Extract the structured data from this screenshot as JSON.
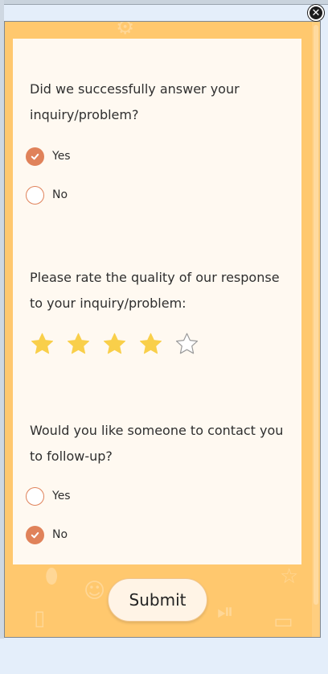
{
  "survey": {
    "q1": {
      "text": "Did we successfully answer your inquiry/problem?",
      "options": [
        {
          "label": "Yes",
          "checked": true
        },
        {
          "label": "No",
          "checked": false
        }
      ]
    },
    "q2": {
      "text": "Please rate the quality of our response to your inquiry/problem:",
      "rating": 4,
      "max_rating": 5
    },
    "q3": {
      "text": "Would you like someone to contact you to follow-up?",
      "options": [
        {
          "label": "Yes",
          "checked": false
        },
        {
          "label": "No",
          "checked": true
        }
      ]
    },
    "submit_label": "Submit"
  },
  "icons": {
    "close": "close-icon",
    "check": "checkmark-icon",
    "star": "star-icon"
  },
  "colors": {
    "background": "#ffc86e",
    "card": "#fff9f1",
    "accent": "#e0825a",
    "star_filled": "#f9cf4a",
    "star_empty": "#ffffff"
  }
}
